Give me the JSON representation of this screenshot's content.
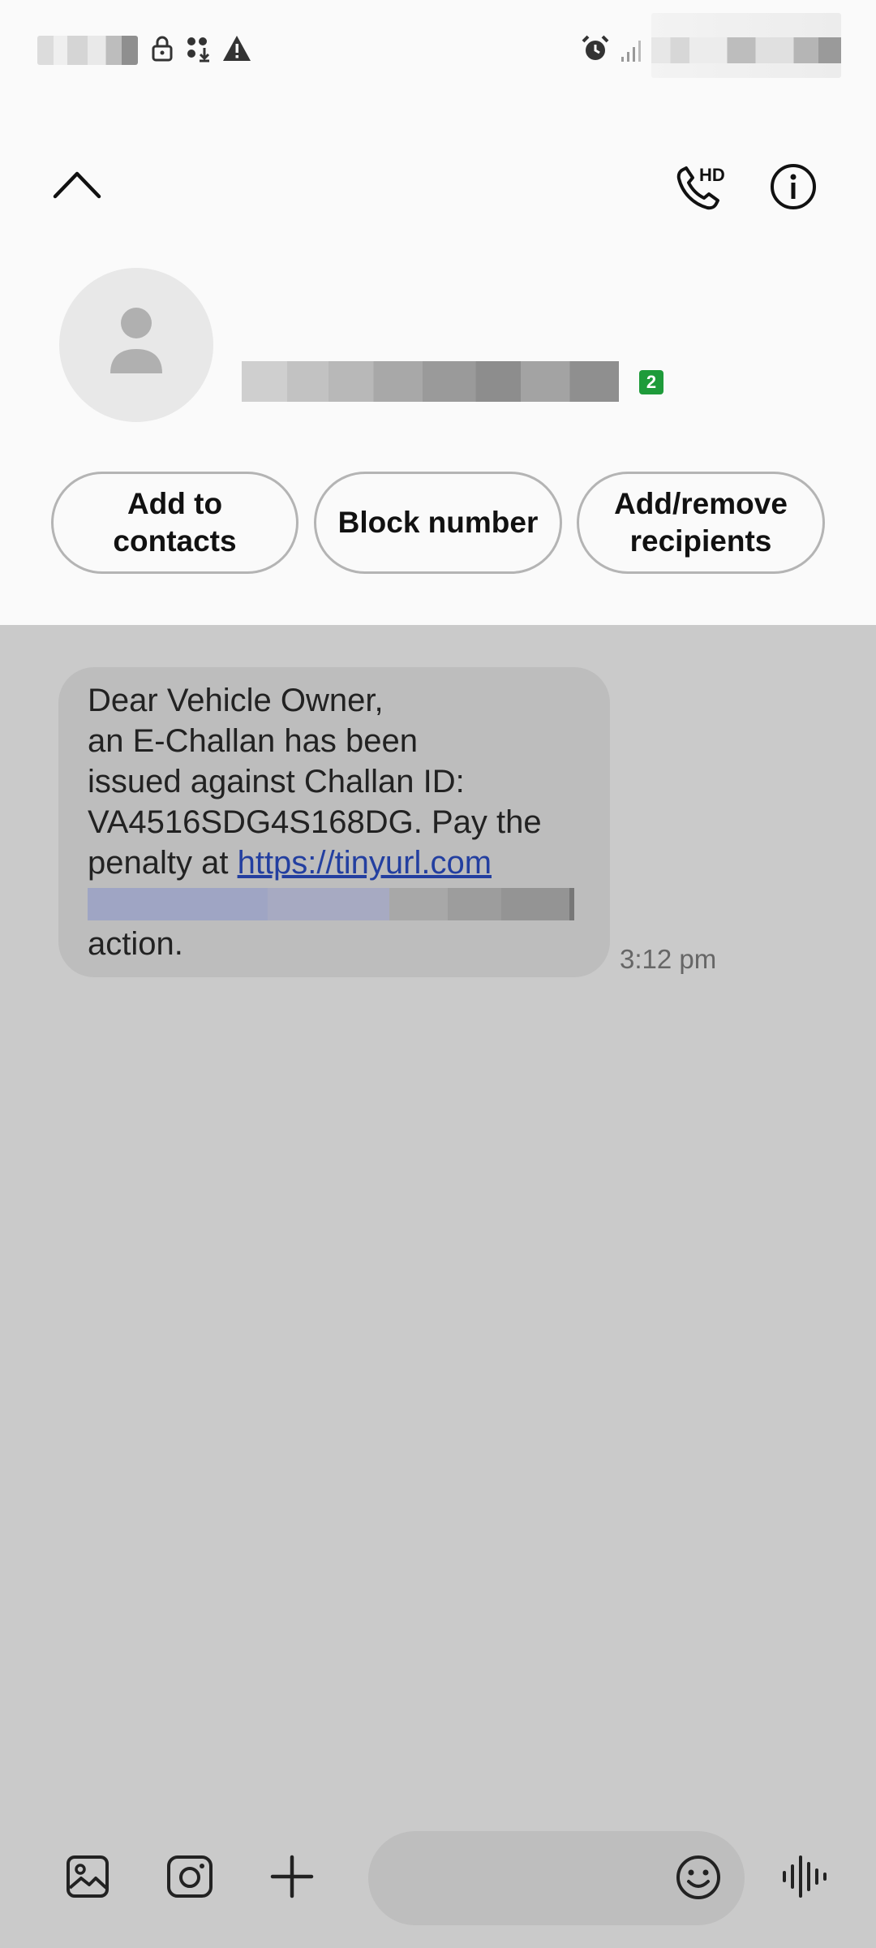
{
  "header": {
    "sim_badge": "2",
    "actions": {
      "add_contacts_line1": "Add to",
      "add_contacts_line2": "contacts",
      "block": "Block number",
      "recipients_line1": "Add/remove",
      "recipients_line2": "recipients"
    }
  },
  "message": {
    "lines": [
      "Dear Vehicle Owner,",
      "an E-Challan has been",
      "issued against Challan ID:",
      "VA4516SDG4S168DG. Pay the"
    ],
    "penalty_prefix": "penalty at ",
    "link": "https://tinyurl.com",
    "last_line": "action.",
    "time": "3:12 pm"
  },
  "icons": {
    "collapse": "chevron-up-icon",
    "call": "hd-call-icon",
    "info": "info-icon",
    "gallery": "gallery-icon",
    "camera": "camera-icon",
    "add": "plus-icon",
    "emoji": "emoji-icon",
    "voice": "voice-wave-icon"
  },
  "colors": {
    "header_bg": "#fafafa",
    "chat_bg": "#cacaca",
    "bubble_bg": "#bdbdbd",
    "link": "#233fa0",
    "sim_badge": "#1e9b3a"
  }
}
